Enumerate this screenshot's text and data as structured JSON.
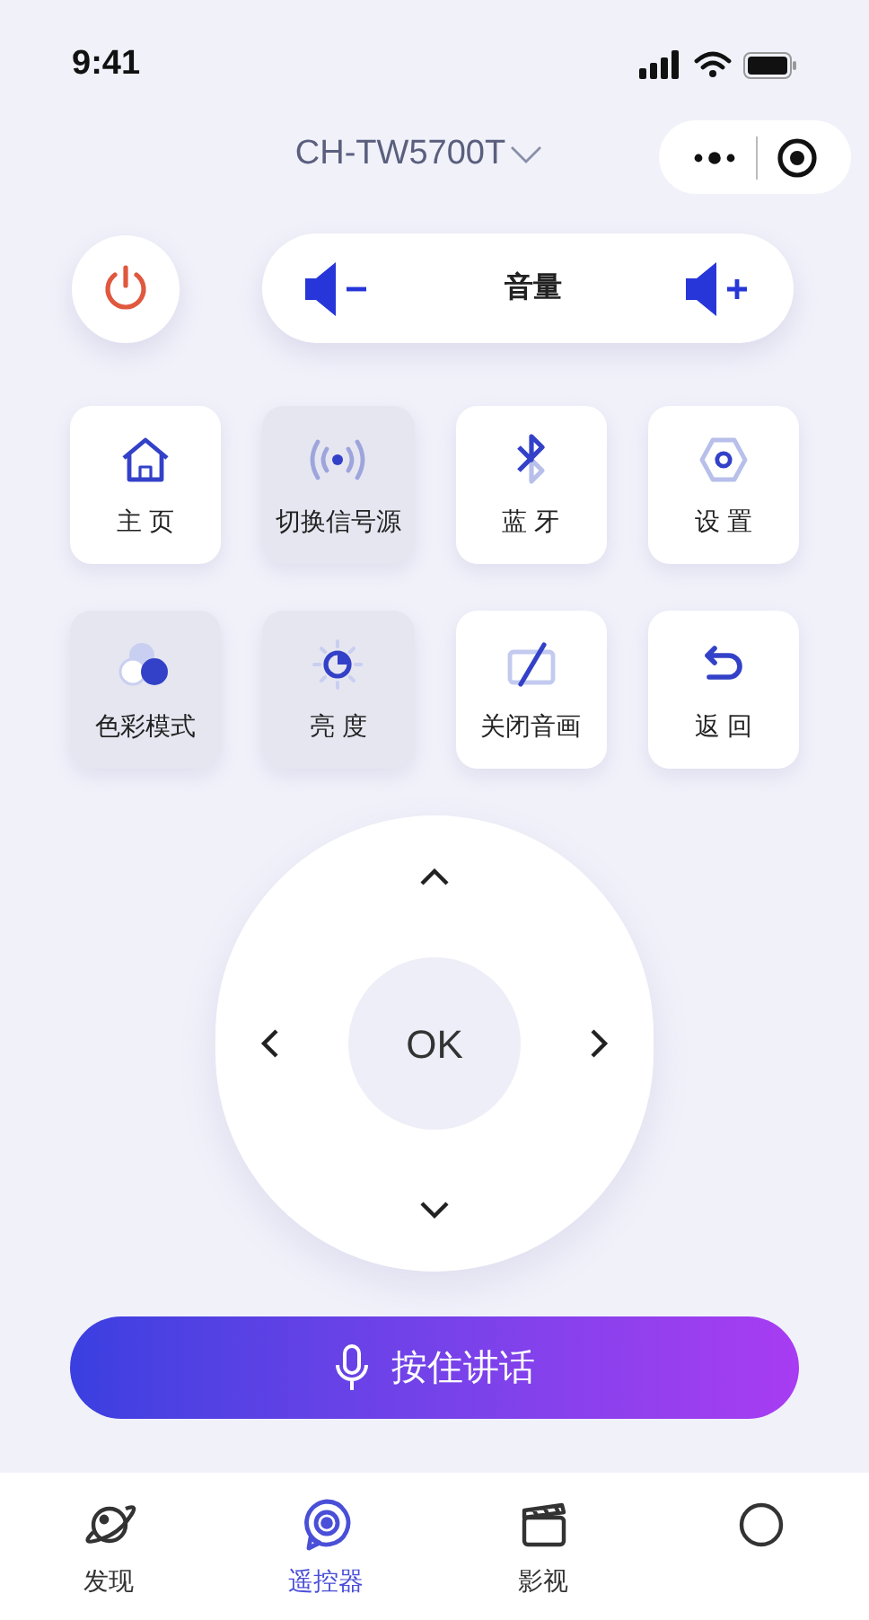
{
  "status_bar": {
    "time": "9:41"
  },
  "header": {
    "device": "CH-TW5700T"
  },
  "volume": {
    "label": "音量"
  },
  "keys": [
    {
      "label": "主 页",
      "pressed": false
    },
    {
      "label": "切换信号源",
      "pressed": true
    },
    {
      "label": "蓝 牙",
      "pressed": false
    },
    {
      "label": "设 置",
      "pressed": false
    },
    {
      "label": "色彩模式",
      "pressed": true
    },
    {
      "label": "亮 度",
      "pressed": true
    },
    {
      "label": "关闭音画",
      "pressed": false
    },
    {
      "label": "返 回",
      "pressed": false
    }
  ],
  "dpad": {
    "ok": "OK"
  },
  "voice_button": {
    "label": "按住讲话"
  },
  "tabs": [
    {
      "label": "发现",
      "selected": false
    },
    {
      "label": "遥控器",
      "selected": true
    },
    {
      "label": "影视",
      "selected": false
    },
    {
      "selected": false
    }
  ]
}
